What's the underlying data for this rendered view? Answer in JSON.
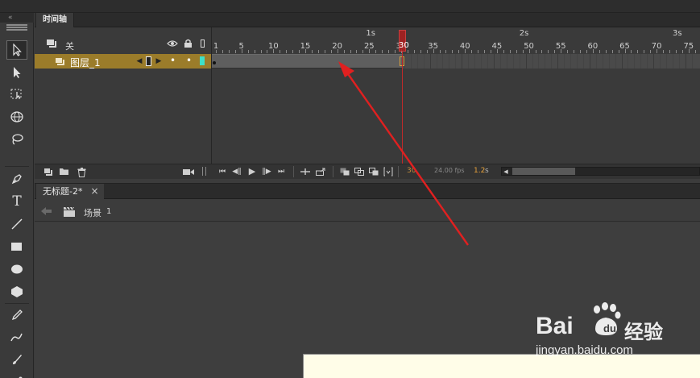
{
  "app": {
    "panel_tab": "时间轴",
    "document_tab": "无标题-2*",
    "close_glyph": "×"
  },
  "layers_header": {
    "label": "关",
    "eye_icon": "eye-icon",
    "lock_icon": "lock-icon"
  },
  "layer": {
    "name": "图层_1",
    "current_frame_dot": "•"
  },
  "ruler": {
    "seconds": [
      "1s",
      "2s",
      "3s"
    ],
    "frames": [
      "1",
      "5",
      "10",
      "15",
      "20",
      "25",
      "30",
      "35",
      "40",
      "45",
      "50",
      "55",
      "60",
      "65",
      "70",
      "75"
    ]
  },
  "playback": {
    "current_frame": "30",
    "fps": "24.00 fps",
    "time": "1.2",
    "time_unit": "s"
  },
  "scene": {
    "label": "场景",
    "number": "1"
  },
  "watermark": {
    "brand_left": "Bai",
    "brand_right": "经验",
    "url": "jingyan.baidu.com"
  },
  "colors": {
    "layer_highlight": "#9b7c2a",
    "playhead": "#c02a2a",
    "annotation_arrow": "#e02020",
    "stage_canvas": "#fffde8",
    "current_frame_text": "#e6a23c"
  }
}
